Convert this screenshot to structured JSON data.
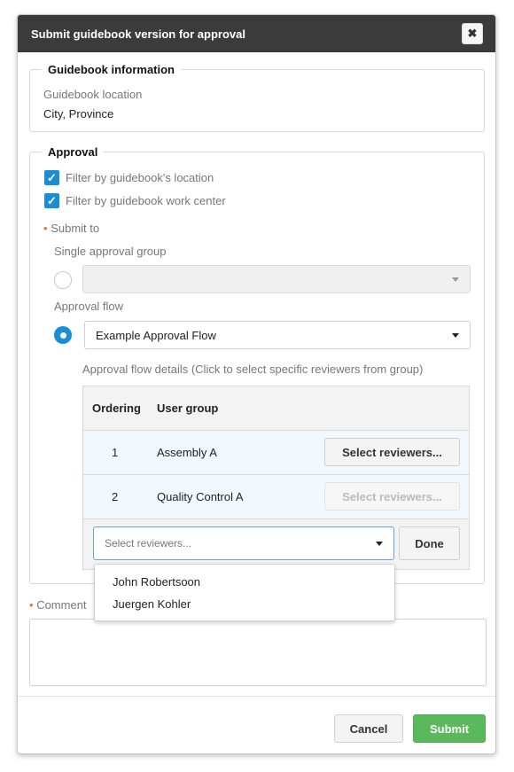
{
  "dialog": {
    "title": "Submit guidebook version for approval",
    "close_icon": "✖"
  },
  "guidebook_info": {
    "legend": "Guidebook information",
    "location_label": "Guidebook location",
    "location_value": "City, Province"
  },
  "approval": {
    "legend": "Approval",
    "filter_location_label": "Filter by guidebook's location",
    "filter_location_checked": true,
    "filter_workcenter_label": "Filter by guidebook work center",
    "filter_workcenter_checked": true,
    "submit_to_label": "Submit to",
    "single_group_label": "Single approval group",
    "single_group_value": "",
    "approval_flow_label": "Approval flow",
    "approval_flow_value": "Example Approval Flow",
    "flow_details_label": "Approval flow details (Click to select specific reviewers from group)",
    "table": {
      "headers": [
        "Ordering",
        "User group",
        ""
      ],
      "rows": [
        {
          "ordering": "1",
          "group": "Assembly A",
          "action": "Select reviewers...",
          "enabled": true
        },
        {
          "ordering": "2",
          "group": "Quality Control A",
          "action": "Select reviewers...",
          "enabled": false
        }
      ]
    },
    "reviewer_select_placeholder": "Select reviewers...",
    "done_label": "Done",
    "reviewer_options": [
      "John Robertsoon",
      "Juergen Kohler"
    ]
  },
  "comment": {
    "label": "Comment",
    "value": ""
  },
  "footer": {
    "cancel_label": "Cancel",
    "submit_label": "Submit"
  },
  "colors": {
    "header_bg": "#3b3b3b",
    "accent_blue": "#1a8ed4",
    "submit_green": "#5cb85c",
    "required_dot": "#d97a2c"
  }
}
